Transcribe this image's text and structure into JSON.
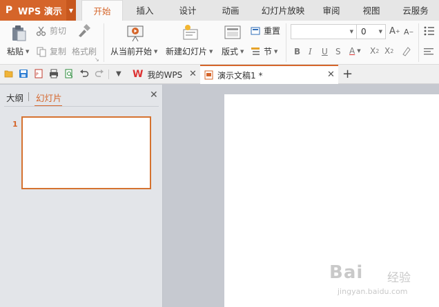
{
  "app": {
    "name": "WPS 演示",
    "logo": "P",
    "accent": "#d5652a"
  },
  "menu": {
    "tabs": [
      {
        "label": "开始",
        "active": true
      },
      {
        "label": "插入"
      },
      {
        "label": "设计"
      },
      {
        "label": "动画"
      },
      {
        "label": "幻灯片放映"
      },
      {
        "label": "审阅"
      },
      {
        "label": "视图"
      },
      {
        "label": "云服务"
      }
    ]
  },
  "ribbon": {
    "paste": "粘贴",
    "cut": "剪切",
    "copy": "复制",
    "format_painter": "格式刷",
    "play_from_current": "从当前开始",
    "new_slide": "新建幻灯片",
    "layout": "版式",
    "reset": "重置",
    "section": "节",
    "font_size": "0",
    "font_name": ""
  },
  "doc_tabs": [
    {
      "label": "我的WPS",
      "icon": "wps-logo-icon"
    },
    {
      "label": "演示文稿1 *",
      "icon": "presentation-doc-icon",
      "active": true
    }
  ],
  "left_pane": {
    "tabs": [
      "大纲",
      "幻灯片"
    ],
    "active_tab": "幻灯片",
    "slides": [
      {
        "number": "1"
      }
    ]
  },
  "watermark": {
    "brand": "Bai",
    "brand2": "经验",
    "url": "jingyan.baidu.com"
  }
}
